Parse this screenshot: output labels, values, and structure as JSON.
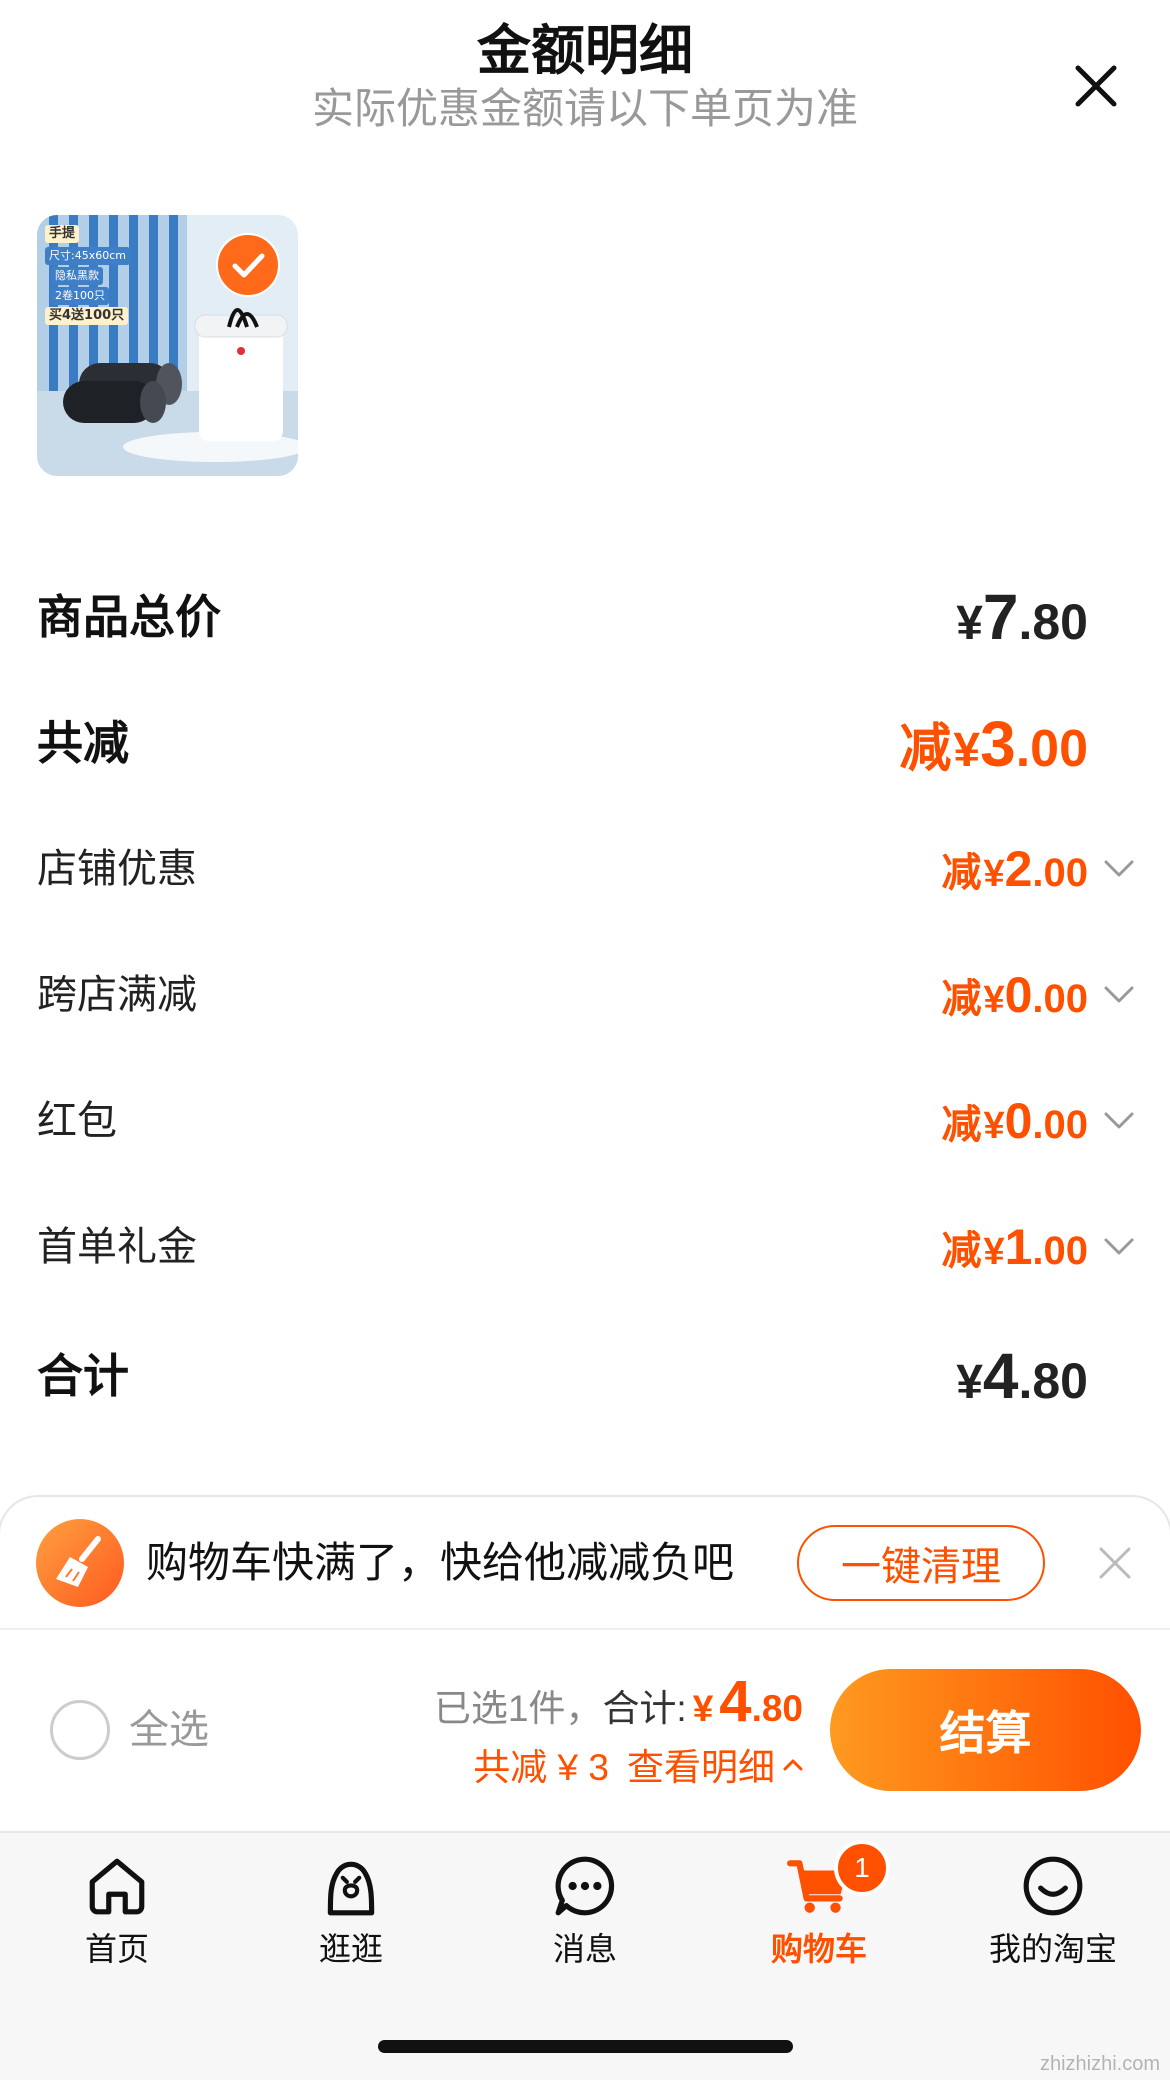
{
  "header": {
    "title": "金额明细",
    "subtitle": "实际优惠金额请以下单页为准",
    "close_icon": "close-icon"
  },
  "product": {
    "selected": true,
    "check_icon": "check-circle-icon",
    "image_labels": {
      "handle": "手提",
      "size": "尺寸:45x60cm",
      "style": "隐私黑款",
      "count": "2卷100只",
      "promo": "买4送100只"
    }
  },
  "summary": {
    "total_price": {
      "label": "商品总价",
      "currency": "¥",
      "integer": "7",
      "decimal": ".80"
    },
    "total_discount": {
      "label": "共减",
      "prefix": "减",
      "currency": "¥",
      "integer": "3",
      "decimal": ".00"
    },
    "discounts": [
      {
        "label": "店铺优惠",
        "prefix": "减",
        "currency": "¥",
        "integer": "2",
        "decimal": ".00",
        "icon": "chevron-down-icon"
      },
      {
        "label": "跨店满减",
        "prefix": "减",
        "currency": "¥",
        "integer": "0",
        "decimal": ".00",
        "icon": "chevron-down-icon"
      },
      {
        "label": "红包",
        "prefix": "减",
        "currency": "¥",
        "integer": "0",
        "decimal": ".00",
        "icon": "chevron-down-icon"
      },
      {
        "label": "首单礼金",
        "prefix": "减",
        "currency": "¥",
        "integer": "1",
        "decimal": ".00",
        "icon": "chevron-down-icon"
      }
    ],
    "grand_total": {
      "label": "合计",
      "currency": "¥",
      "integer": "4",
      "decimal": ".80"
    }
  },
  "banner": {
    "icon": "broom-icon",
    "message": "购物车快满了，快给他减减负吧",
    "button_label": "一键清理",
    "close_icon": "close-icon"
  },
  "checkout_bar": {
    "select_all_label": "全选",
    "selected_text": "已选1件，",
    "total_label": "合计:",
    "currency": "¥",
    "integer": "4",
    "decimal": ".80",
    "discount_text": "共减 ¥ 3",
    "detail_link": "查看明细",
    "detail_icon": "chevron-up-icon",
    "checkout_label": "结算"
  },
  "tabbar": {
    "tabs": [
      {
        "label": "首页",
        "icon": "home-icon"
      },
      {
        "label": "逛逛",
        "icon": "guangguang-icon"
      },
      {
        "label": "消息",
        "icon": "message-icon"
      },
      {
        "label": "购物车",
        "icon": "cart-icon",
        "active": true
      },
      {
        "label": "我的淘宝",
        "icon": "smile-icon"
      }
    ],
    "cart_badge": "1"
  },
  "watermark": "zhizhizhi.com",
  "colors": {
    "accent": "#ff5000",
    "checkout_gradient_start": "#ff9a1f",
    "checkout_gradient_end": "#ff5000",
    "text_primary": "#111111",
    "text_secondary": "#999999",
    "tabbar_bg": "#f7f7f7"
  }
}
